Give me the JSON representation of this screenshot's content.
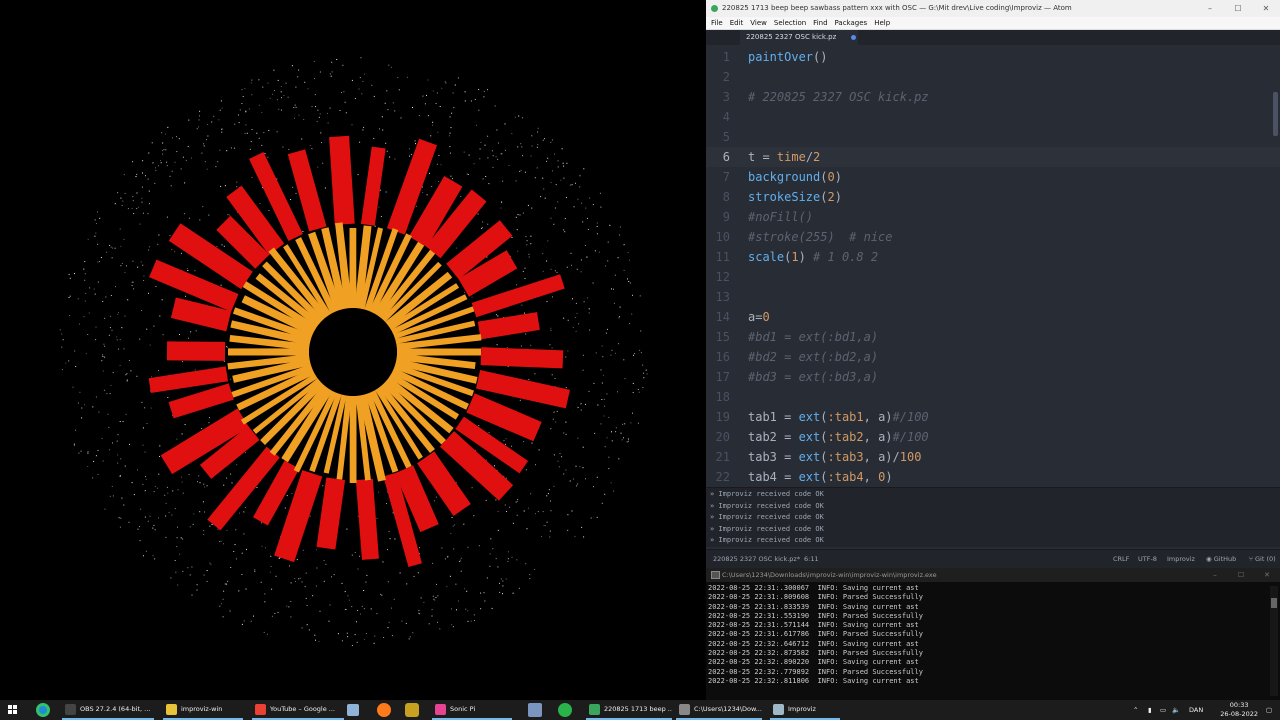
{
  "visual": {
    "background": "#000000",
    "ring_inner_color": "#f0a023",
    "ring_outer_color": "#e01010",
    "particle_color": "#ffffff"
  },
  "atom": {
    "title": "220825 1713 beep beep sawbass pattern xxx with OSC — G:\\Mit drev\\Live coding\\Improviz — Atom",
    "menu": [
      "File",
      "Edit",
      "View",
      "Selection",
      "Find",
      "Packages",
      "Help"
    ],
    "tab_label": "220825 2327 OSC kick.pz",
    "lines": [
      {
        "n": "1",
        "parts": [
          [
            "fn",
            "paintOver"
          ],
          [
            "plain",
            "()"
          ]
        ]
      },
      {
        "n": "2",
        "parts": []
      },
      {
        "n": "3",
        "parts": [
          [
            "com",
            "# 220825 2327 OSC kick.pz"
          ]
        ]
      },
      {
        "n": "4",
        "parts": []
      },
      {
        "n": "5",
        "parts": []
      },
      {
        "n": "6",
        "current": true,
        "parts": [
          [
            "plain",
            "t = "
          ],
          [
            "num",
            "time"
          ],
          [
            "plain",
            "/"
          ],
          [
            "num",
            "2"
          ]
        ]
      },
      {
        "n": "7",
        "parts": [
          [
            "fn",
            "background"
          ],
          [
            "plain",
            "("
          ],
          [
            "num",
            "0"
          ],
          [
            "plain",
            ")"
          ]
        ]
      },
      {
        "n": "8",
        "parts": [
          [
            "fn",
            "strokeSize"
          ],
          [
            "plain",
            "("
          ],
          [
            "num",
            "2"
          ],
          [
            "plain",
            ")"
          ]
        ]
      },
      {
        "n": "9",
        "parts": [
          [
            "com",
            "#noFill()"
          ]
        ]
      },
      {
        "n": "10",
        "parts": [
          [
            "com",
            "#stroke(255)  # nice"
          ]
        ]
      },
      {
        "n": "11",
        "parts": [
          [
            "fn",
            "scale"
          ],
          [
            "plain",
            "("
          ],
          [
            "num",
            "1"
          ],
          [
            "plain",
            ") "
          ],
          [
            "com",
            "# 1 0.8 2"
          ]
        ]
      },
      {
        "n": "12",
        "parts": []
      },
      {
        "n": "13",
        "parts": []
      },
      {
        "n": "14",
        "parts": [
          [
            "plain",
            "a="
          ],
          [
            "num",
            "0"
          ]
        ]
      },
      {
        "n": "15",
        "parts": [
          [
            "com",
            "#bd1 = ext(:bd1,a)"
          ]
        ]
      },
      {
        "n": "16",
        "parts": [
          [
            "com",
            "#bd2 = ext(:bd2,a)"
          ]
        ]
      },
      {
        "n": "17",
        "parts": [
          [
            "com",
            "#bd3 = ext(:bd3,a)"
          ]
        ]
      },
      {
        "n": "18",
        "parts": []
      },
      {
        "n": "19",
        "parts": [
          [
            "plain",
            "tab1 = "
          ],
          [
            "fn",
            "ext"
          ],
          [
            "plain",
            "("
          ],
          [
            "sym",
            ":tab1"
          ],
          [
            "plain",
            ", a)"
          ],
          [
            "com",
            "#/100"
          ]
        ]
      },
      {
        "n": "20",
        "parts": [
          [
            "plain",
            "tab2 = "
          ],
          [
            "fn",
            "ext"
          ],
          [
            "plain",
            "("
          ],
          [
            "sym",
            ":tab2"
          ],
          [
            "plain",
            ", a)"
          ],
          [
            "com",
            "#/100"
          ]
        ]
      },
      {
        "n": "21",
        "parts": [
          [
            "plain",
            "tab3 = "
          ],
          [
            "fn",
            "ext"
          ],
          [
            "plain",
            "("
          ],
          [
            "sym",
            ":tab3"
          ],
          [
            "plain",
            ", a)/"
          ],
          [
            "num",
            "100"
          ]
        ]
      },
      {
        "n": "22",
        "parts": [
          [
            "plain",
            "tab4 = "
          ],
          [
            "fn",
            "ext"
          ],
          [
            "plain",
            "("
          ],
          [
            "sym",
            ":tab4"
          ],
          [
            "plain",
            ", "
          ],
          [
            "num",
            "0"
          ],
          [
            "plain",
            ")"
          ]
        ]
      }
    ],
    "console": [
      "» Improviz received code OK",
      "» Improviz received code OK",
      "» Improviz received code OK",
      "» Improviz received code OK",
      "» Improviz received code OK"
    ],
    "status": {
      "file": "220825 2327 OSC kick.pz*",
      "cursor": "6:11",
      "eol": "CRLF",
      "encoding": "UTF-8",
      "grammar": "Improviz",
      "github": "GitHub",
      "git": "Git (0)"
    }
  },
  "cmd": {
    "title": "C:\\Users\\1234\\Downloads\\improviz-win\\improviz-win\\improviz.exe",
    "log": [
      "2022-08-25 22:31:.300067  INFO: Saving current ast",
      "2022-08-25 22:31:.809608  INFO: Parsed Successfully",
      "2022-08-25 22:31:.833539  INFO: Saving current ast",
      "2022-08-25 22:31:.553190  INFO: Parsed Successfully",
      "2022-08-25 22:31:.571144  INFO: Saving current ast",
      "2022-08-25 22:31:.617786  INFO: Parsed Successfully",
      "2022-08-25 22:32:.646712  INFO: Saving current ast",
      "2022-08-25 22:32:.873582  INFO: Parsed Successfully",
      "2022-08-25 22:32:.890220  INFO: Saving current ast",
      "2022-08-25 22:32:.779892  INFO: Parsed Successfully",
      "2022-08-25 22:32:.811806  INFO: Saving current ast"
    ]
  },
  "taskbar": {
    "items": [
      {
        "label": "OBS 27.2.4 (64-bit, ...",
        "color": "#444444",
        "icon": "obs-icon"
      },
      {
        "label": "improviz-win",
        "color": "#e8c33a",
        "icon": "folder-icon"
      },
      {
        "label": "YouTube – Google ...",
        "color": "#e94235",
        "icon": "chrome-icon"
      },
      {
        "label": "Sonic Pi",
        "color": "#e84393",
        "icon": "sonic-pi-icon"
      },
      {
        "label": "220825 1713 beep ...",
        "color": "#3aa55c",
        "icon": "atom-icon"
      },
      {
        "label": "C:\\Users\\1234\\Dow...",
        "color": "#888888",
        "icon": "terminal-icon"
      },
      {
        "label": "Improviz",
        "color": "#9fb8c8",
        "icon": "improviz-icon"
      }
    ],
    "lang": "DAN",
    "time": "00:33",
    "date": "26-08-2022"
  }
}
